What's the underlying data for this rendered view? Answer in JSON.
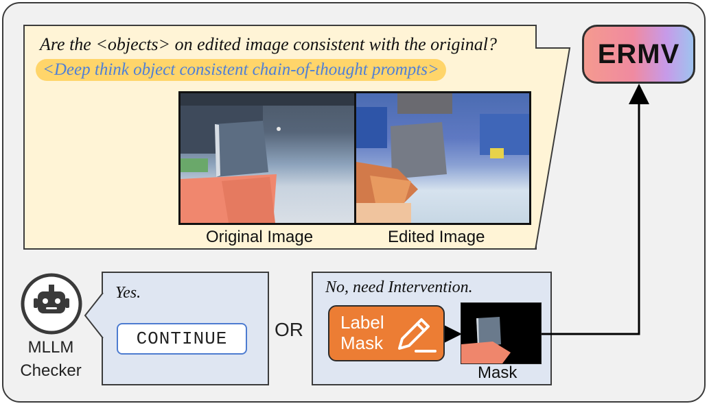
{
  "prompt": {
    "question": "Are the <objects> on edited image consistent with the original?",
    "highlight": "<Deep think object consistent chain-of-thought prompts>",
    "original_caption": "Original Image",
    "edited_caption": "Edited Image"
  },
  "ermv": {
    "label": "ERMV"
  },
  "checker": {
    "line1": "MLLM",
    "line2": "Checker"
  },
  "yes_branch": {
    "text": "Yes.",
    "button": "CONTINUE"
  },
  "or_label": "OR",
  "no_branch": {
    "text": "No, need Intervention.",
    "label_mask_line1": "Label",
    "label_mask_line2": "Mask",
    "mask_caption": "Mask"
  },
  "colors": {
    "prompt_bg": "#fff4d6",
    "highlight": "#ffd56a",
    "highlight_text": "#4f7fd6",
    "branch_bg": "#dfe6f2",
    "label_mask_bg": "#ec7d34",
    "continue_border": "#4c7bd0"
  },
  "icons": [
    "robot-icon",
    "pencil-icon"
  ]
}
